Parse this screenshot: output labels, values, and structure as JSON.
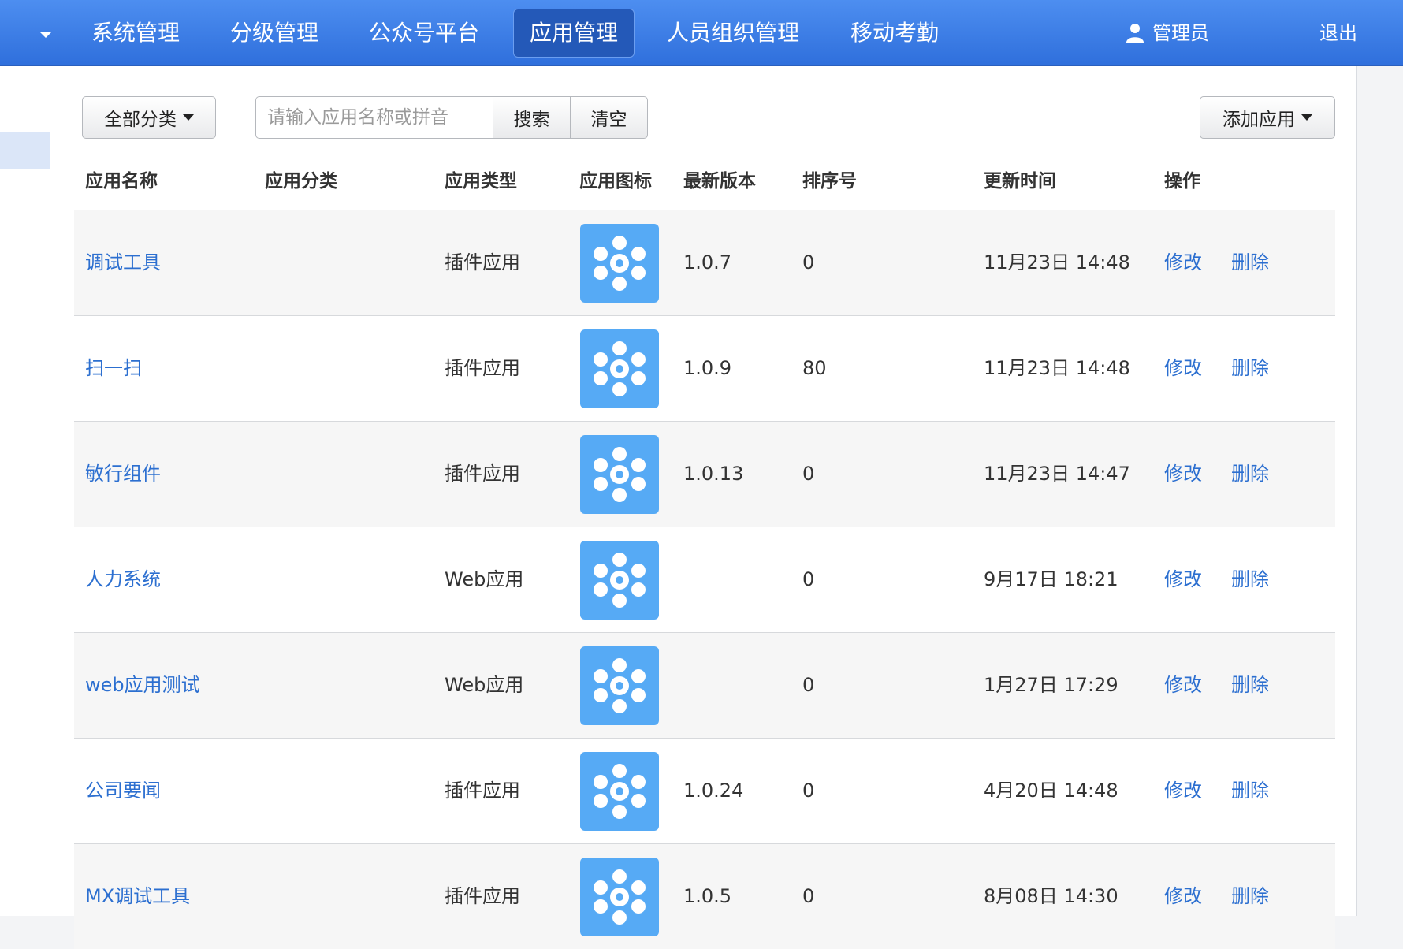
{
  "nav": {
    "items": [
      {
        "label": "系统管理",
        "active": false
      },
      {
        "label": "分级管理",
        "active": false
      },
      {
        "label": "公众号平台",
        "active": false
      },
      {
        "label": "应用管理",
        "active": true
      },
      {
        "label": "人员组织管理",
        "active": false
      },
      {
        "label": "移动考勤",
        "active": false
      }
    ],
    "user": "管理员",
    "logout": "退出",
    "accent": "#2f6fdc"
  },
  "toolbar": {
    "category_label": "全部分类",
    "search_placeholder": "请输入应用名称或拼音",
    "search_value": "",
    "search_label": "搜索",
    "clear_label": "清空",
    "add_label": "添加应用"
  },
  "table": {
    "headers": {
      "name": "应用名称",
      "category": "应用分类",
      "type": "应用类型",
      "icon": "应用图标",
      "version": "最新版本",
      "order": "排序号",
      "updated": "更新时间",
      "actions": "操作"
    },
    "rows": [
      {
        "name": "调试工具",
        "category": "",
        "type": "插件应用",
        "version": "1.0.7",
        "order": "0",
        "updated": "11月23日 14:48",
        "edit": "修改",
        "delete": "删除"
      },
      {
        "name": "扫一扫",
        "category": "",
        "type": "插件应用",
        "version": "1.0.9",
        "order": "80",
        "updated": "11月23日 14:48",
        "edit": "修改",
        "delete": "删除"
      },
      {
        "name": "敏行组件",
        "category": "",
        "type": "插件应用",
        "version": "1.0.13",
        "order": "0",
        "updated": "11月23日 14:47",
        "edit": "修改",
        "delete": "删除"
      },
      {
        "name": "人力系统",
        "category": "",
        "type": "Web应用",
        "version": "",
        "order": "0",
        "updated": "9月17日 18:21",
        "edit": "修改",
        "delete": "删除"
      },
      {
        "name": "web应用测试",
        "category": "",
        "type": "Web应用",
        "version": "",
        "order": "0",
        "updated": "1月27日 17:29",
        "edit": "修改",
        "delete": "删除"
      },
      {
        "name": "公司要闻",
        "category": "",
        "type": "插件应用",
        "version": "1.0.24",
        "order": "0",
        "updated": "4月20日 14:48",
        "edit": "修改",
        "delete": "删除"
      },
      {
        "name": "MX调试工具",
        "category": "",
        "type": "插件应用",
        "version": "1.0.5",
        "order": "0",
        "updated": "8月08日 14:30",
        "edit": "修改",
        "delete": "删除"
      }
    ],
    "icon_color": "#56aaf5",
    "link_color": "#2c6fd0"
  }
}
